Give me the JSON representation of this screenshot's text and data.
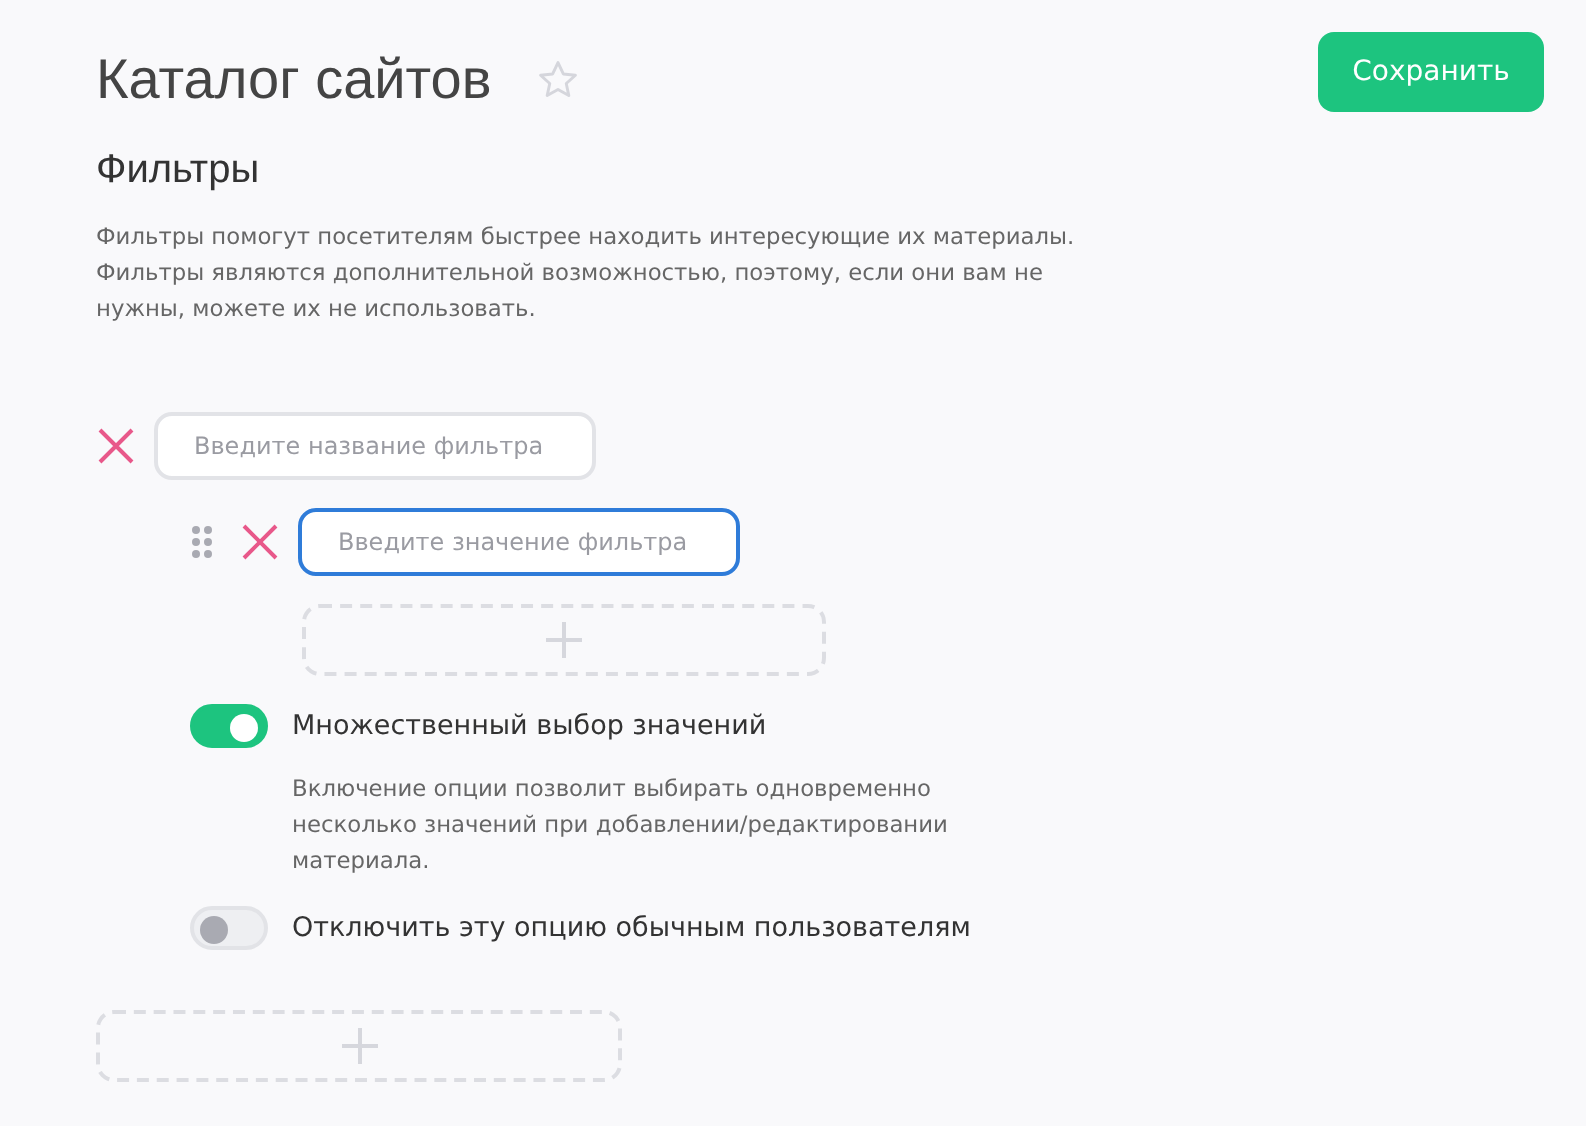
{
  "header": {
    "title": "Каталог сайтов",
    "favorite": false,
    "save_button": "Сохранить"
  },
  "section": {
    "title": "Фильтры",
    "description": "Фильтры помогут посетителям быстрее находить интересующие их материалы. Фильтры являются дополнительной возможностью, поэтому, если они вам не нужны, можете их не использовать."
  },
  "filters": [
    {
      "name_placeholder": "Введите название фильтра",
      "values": [
        {
          "placeholder": "Введите значение фильтра",
          "focused": true
        }
      ],
      "options": [
        {
          "label": "Множественный выбор значений",
          "on": true,
          "hint": "Включение опции позволит выбирать одновременно несколько значений при добавлении/редактировании материала."
        },
        {
          "label": "Отключить эту опцию обычным пользователям",
          "on": false
        }
      ]
    }
  ]
}
